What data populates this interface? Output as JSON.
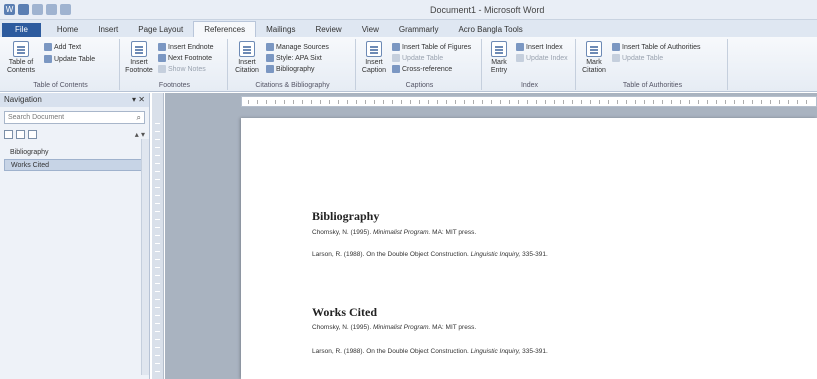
{
  "window": {
    "title": "Document1 - Microsoft Word"
  },
  "tabs": [
    "File",
    "Home",
    "Insert",
    "Page Layout",
    "References",
    "Mailings",
    "Review",
    "View",
    "Grammarly",
    "Acro Bangla Tools"
  ],
  "active_tab": "References",
  "ribbon": {
    "toc": {
      "big": "Table of Contents",
      "add_text": "Add Text",
      "update_table": "Update Table",
      "group": "Table of Contents"
    },
    "footnotes": {
      "big": "Insert Footnote",
      "insert_endnote": "Insert Endnote",
      "next_footnote": "Next Footnote",
      "show_notes": "Show Notes",
      "group": "Footnotes"
    },
    "citations": {
      "big": "Insert Citation",
      "manage_sources": "Manage Sources",
      "style": "Style: APA Sixt",
      "bibliography": "Bibliography",
      "group": "Citations & Bibliography"
    },
    "captions": {
      "big": "Insert Caption",
      "insert_table_of_figures": "Insert Table of Figures",
      "update_table": "Update Table",
      "cross_reference": "Cross-reference",
      "group": "Captions"
    },
    "index": {
      "big": "Mark Entry",
      "insert_index": "Insert Index",
      "update_index": "Update Index",
      "group": "Index"
    },
    "authorities": {
      "big": "Mark Citation",
      "insert_toa": "Insert Table of Authorities",
      "update_table": "Update Table",
      "group": "Table of Authorities"
    }
  },
  "navigation": {
    "title": "Navigation",
    "search_placeholder": "Search Document",
    "items": [
      "Bibliography",
      "Works Cited"
    ],
    "selected_index": 1
  },
  "document": {
    "sections": [
      {
        "heading": "Bibliography",
        "entries": [
          {
            "prefix": "Chomsky, N. (1995). ",
            "italic": "Minimalist Program.",
            "suffix": " MA: MIT press."
          },
          {
            "prefix": "Larson, R. (1988). On the Double Object Construction. ",
            "italic": "Linguistic Inquiry,",
            "suffix": " 335-391."
          }
        ]
      },
      {
        "heading": "Works Cited",
        "entries": [
          {
            "prefix": "Chomsky, N. (1995). ",
            "italic": "Minimalist Program.",
            "suffix": " MA: MIT press."
          },
          {
            "prefix": "Larson, R. (1988). On the Double Object Construction. ",
            "italic": "Linguistic Inquiry,",
            "suffix": " 335-391."
          }
        ]
      }
    ]
  }
}
